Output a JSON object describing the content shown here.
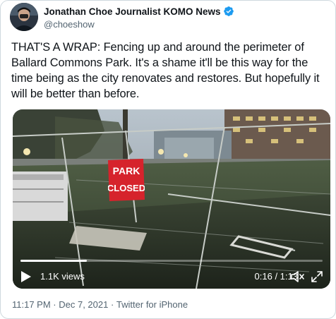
{
  "author": {
    "display_name": "Jonathan Choe Journalist KOMO News",
    "handle": "@choeshow",
    "verified": true,
    "verified_color": "#1d9bf0"
  },
  "tweet": {
    "text": "THAT'S A WRAP: Fencing up and around the perimeter of Ballard Commons Park. It's a shame it'll be this way for the time being as the city renovates and restores. But hopefully it will be better than before."
  },
  "video": {
    "views": "1.1K views",
    "timecode": "0:16 / 1:13",
    "progress": 0.22,
    "sign_text_top": "PARK",
    "sign_text_bottom": "CLOSED",
    "sign_color": "#d6232c"
  },
  "meta": {
    "time": "11:17 PM",
    "separator_1": " · ",
    "date": "Dec 7, 2021",
    "separator_2": " · ",
    "source": "Twitter for iPhone"
  },
  "colors": {
    "text_primary": "#0f1419",
    "text_secondary": "#536471",
    "border": "#cfd9de"
  }
}
